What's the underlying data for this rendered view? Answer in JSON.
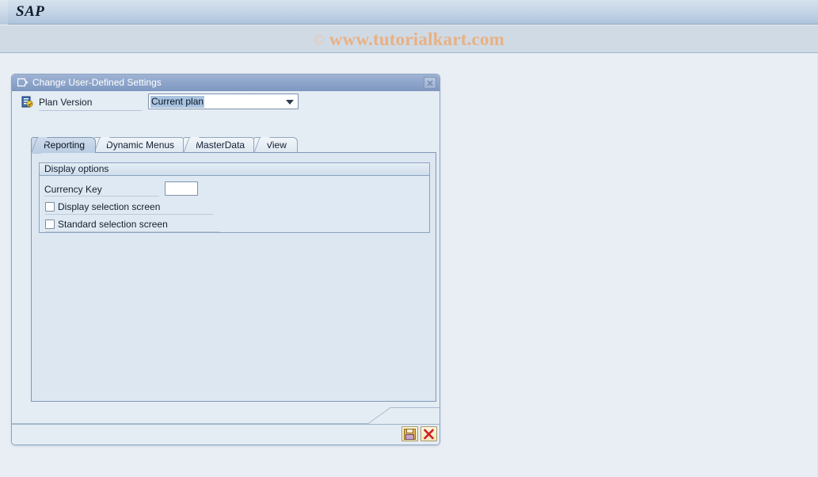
{
  "app": {
    "brand": "SAP",
    "watermark_symbol": "©",
    "watermark_text": "www.tutorialkart.com",
    "accent_title": "#8ea5ca",
    "page_bg": "#e9eef5",
    "watermark_color": "#e8b183"
  },
  "dialog": {
    "title": "Change User-Defined Settings",
    "title_icon": "window-arrow-icon",
    "close_label": "×",
    "plan_version": {
      "icon": "plan-version-icon",
      "label": "Plan Version",
      "value": "Current plan",
      "placeholder": "Current plan",
      "options": [
        "Current plan"
      ]
    },
    "tabs": [
      {
        "label": "Reporting",
        "active": true
      },
      {
        "label": "Dynamic Menus",
        "active": false
      },
      {
        "label": "MasterData",
        "active": false
      },
      {
        "label": "View",
        "active": false
      }
    ],
    "group": {
      "header": "Display options",
      "fields": [
        {
          "label": "Currency Key",
          "value": "",
          "placeholder": ""
        }
      ],
      "checkboxes": [
        {
          "label": "Display selection screen",
          "checked": false
        },
        {
          "label": "Standard selection screen",
          "checked": false
        }
      ]
    },
    "footer": {
      "save_label": "Save",
      "save_icon": "save-floppy-icon",
      "cancel_label": "Cancel",
      "cancel_icon": "cancel-x-icon"
    }
  }
}
